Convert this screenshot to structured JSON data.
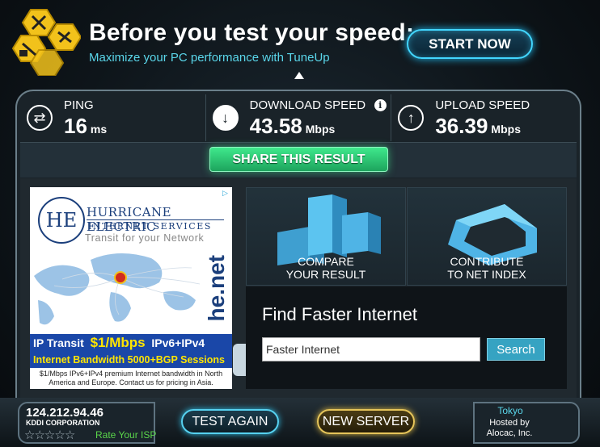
{
  "banner": {
    "title": "Before you test your speed:",
    "subtitle": "Maximize your PC performance with TuneUp",
    "start_label": "START NOW"
  },
  "stats": {
    "ping": {
      "label": "PING",
      "value": "16",
      "unit": "ms"
    },
    "download": {
      "label": "DOWNLOAD SPEED",
      "value": "43.58",
      "unit": "Mbps"
    },
    "upload": {
      "label": "UPLOAD SPEED",
      "value": "36.39",
      "unit": "Mbps"
    }
  },
  "share_label": "SHARE THIS RESULT",
  "ad": {
    "title1": "HURRICANE ELECTRIC",
    "title2": "INTERNET SERVICES",
    "tagline": "Transit for your Network",
    "brand": "he.net",
    "bar1_prefix": "IP Transit",
    "bar1_price": "$1/Mbps",
    "bar1_suffix": "IPv6+IPv4",
    "bar2": "Internet Bandwidth 5000+BGP Sessions",
    "small": "$1/Mbps IPv6+IPv4 premium Internet bandwidth in North America and Europe. Contact us for pricing in Asia."
  },
  "tiles": {
    "compare_line1": "COMPARE",
    "compare_line2": "YOUR RESULT",
    "contribute_line1": "CONTRIBUTE",
    "contribute_line2": "TO NET INDEX"
  },
  "find": {
    "title": "Find Faster Internet",
    "input_value": "Faster Internet",
    "search_label": "Search"
  },
  "footer": {
    "ip": "124.212.94.46",
    "isp": "KDDI CORPORATION",
    "rate_label": "Rate Your ISP",
    "rating": 0,
    "test_again_label": "TEST AGAIN",
    "new_server_label": "NEW SERVER",
    "city": "Tokyo",
    "hosted_line1": "Hosted by",
    "hosted_line2": "Alocac, Inc."
  }
}
